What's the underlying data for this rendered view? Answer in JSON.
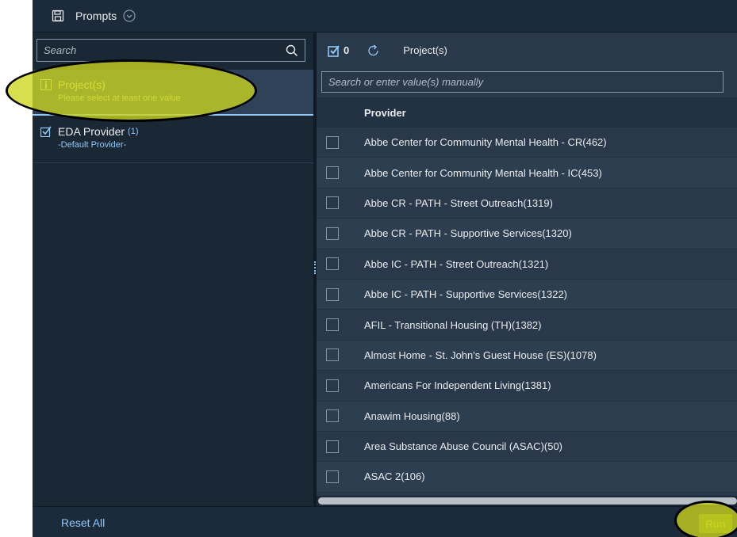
{
  "header": {
    "title": "Prompts"
  },
  "left_panel": {
    "search": {
      "placeholder": "Search"
    },
    "items": [
      {
        "label": "Project(s)",
        "sub": "Please select at least one value",
        "icon": "info-icon"
      },
      {
        "label": "EDA Provider",
        "count": "(1)",
        "sub": "-Default Provider-",
        "icon": "check-icon"
      }
    ]
  },
  "right_panel": {
    "selected_count": "0",
    "title": "Project(s)",
    "value_input": {
      "placeholder": "Search or enter value(s) manually"
    },
    "column_header": "Provider",
    "rows": [
      "Abbe Center for Community Mental Health - CR(462)",
      "Abbe Center for Community Mental Health - IC(453)",
      "Abbe CR - PATH - Street Outreach(1319)",
      "Abbe CR - PATH - Supportive Services(1320)",
      "Abbe IC - PATH - Street Outreach(1321)",
      "Abbe IC - PATH - Supportive Services(1322)",
      "AFIL - Transitional Housing (TH)(1382)",
      "Almost Home - St. John's Guest House (ES)(1078)",
      "Americans For Independent Living(1381)",
      "Anawim Housing(88)",
      "Area Substance Abuse Council (ASAC)(50)",
      "ASAC 2(106)"
    ]
  },
  "footer": {
    "reset_label": "Reset All",
    "run_label": "Run"
  },
  "colors": {
    "accent_blue": "#91c8f6",
    "highlight_yellow": "#ccd61e",
    "panel_dark": "#1a2735",
    "panel_mid": "#29394b"
  }
}
